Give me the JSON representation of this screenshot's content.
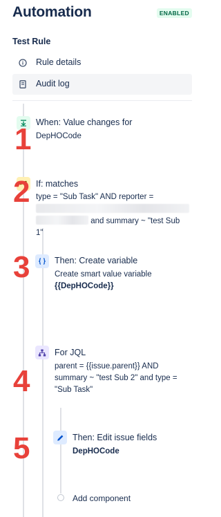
{
  "header": {
    "title": "Automation",
    "status_badge": "ENABLED"
  },
  "rule": {
    "name": "Test Rule"
  },
  "menu": [
    {
      "label": "Rule details",
      "icon": "info-icon",
      "active": false
    },
    {
      "label": "Audit log",
      "icon": "document-icon",
      "active": true
    }
  ],
  "components": {
    "trigger": {
      "title": "When: Value changes for",
      "detail": "DepHOCode",
      "number": "1",
      "icon": "trigger-icon"
    },
    "condition": {
      "title": "If: matches",
      "line1": "type = \"Sub Task\" AND reporter =",
      "line3_suffix": "and summary ~ \"test Sub",
      "line4": "1\"",
      "number": "2",
      "icon": "branch-icon"
    },
    "create_variable": {
      "title": "Then: Create variable",
      "subtitle": "Create smart value variable",
      "variable": "{{DepHOCode}}",
      "number": "3",
      "icon": "braces-icon"
    },
    "for_jql": {
      "title": "For JQL",
      "line1": "parent = {{issue.parent}} AND",
      "line2": "summary ~ \"test Sub 2\" and type =",
      "line3": "\"Sub Task\"",
      "number": "4",
      "icon": "hierarchy-icon"
    },
    "edit_fields": {
      "title": "Then: Edit issue fields",
      "field": "DepHOCode",
      "number": "5",
      "icon": "pencil-icon"
    }
  },
  "add_component": {
    "label": "Add component"
  },
  "colors": {
    "accent_red": "#e8413a",
    "trigger_bg": "#e3fcef",
    "condition_bg": "#fff0b3",
    "action_bg": "#deebff",
    "branch_bg": "#eae6ff"
  }
}
